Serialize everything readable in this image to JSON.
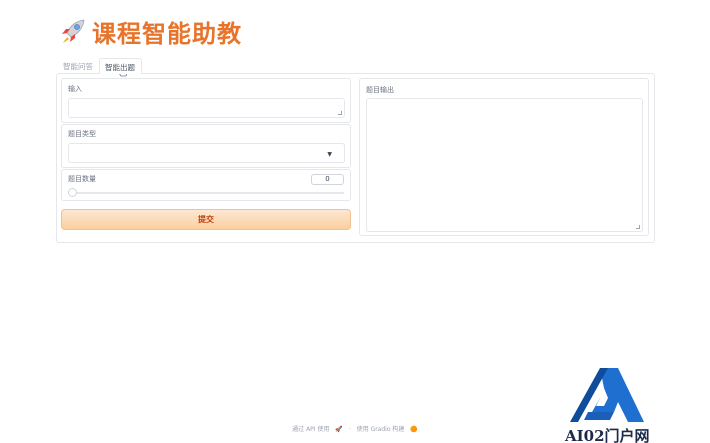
{
  "header": {
    "title": "课程智能助教",
    "icon": "rocket-icon"
  },
  "tabs": [
    {
      "label": "智能问答",
      "active": false
    },
    {
      "label": "智能出题",
      "active": true
    }
  ],
  "form": {
    "input_label": "输入",
    "input_value": "",
    "type_label": "题目类型",
    "type_value": "",
    "count_label": "题目数量",
    "count_value": "0",
    "count_fraction": 0,
    "submit_label": "提交"
  },
  "output": {
    "label": "题目输出",
    "value": ""
  },
  "footer": {
    "api_text": "通过 API 使用",
    "separator": "·",
    "gradio_text": "使用 Gradio 构建"
  },
  "watermark": {
    "text": "AI02门户网"
  },
  "colors": {
    "accent": "#e8742b",
    "button_start": "#fde8d2",
    "button_end": "#fbcf9e",
    "watermark_blue": "#1f6fd1"
  }
}
